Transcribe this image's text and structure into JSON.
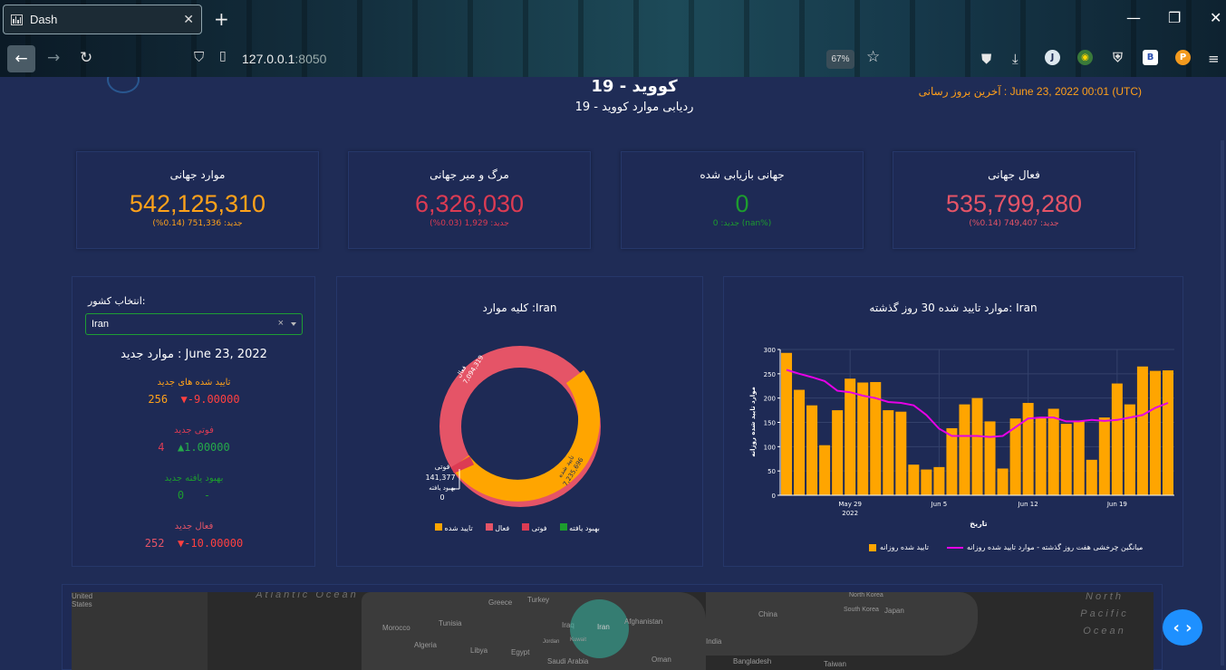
{
  "browser": {
    "tab_title": "Dash",
    "tab_close": "✕",
    "new_tab": "+",
    "url_host": "127.0.0.1",
    "url_port": ":8050",
    "zoom": "67%",
    "window_controls": [
      "—",
      "❐",
      "✕"
    ],
    "extensions": [
      "J",
      "B",
      "P"
    ]
  },
  "header": {
    "title": "کووید - 19",
    "subtitle": "ردیابی موارد کووید - 19",
    "last_update": "آخرین بروز رسانی : June 23, 2022 00:01 (UTC)"
  },
  "cards": [
    {
      "title": "موارد جهانی",
      "value": "542,125,310",
      "sub": "جدید: 751,336 (0.14%)",
      "color": "#ffa21a"
    },
    {
      "title": "مرگ و میر جهانی",
      "value": "6,326,030",
      "sub": "جدید: 1,929 (0.03%)",
      "color": "#dc3b53"
    },
    {
      "title": "جهانی بازیابی شده",
      "value": "0",
      "sub": "جدید: 0 (nan%)",
      "color": "#1d9c2e"
    },
    {
      "title": "فعال جهانی",
      "value": "535,799,280",
      "sub": "جدید: 749,407 (0.14%)",
      "color": "#e55467"
    }
  ],
  "country_panel": {
    "label": "انتخاب کشور:",
    "selected": "Iran",
    "clear": "×",
    "new_cases_date": "موارد جدید : June 23, 2022",
    "stats": [
      {
        "label": "تایید شده های جدید",
        "value": "256",
        "delta": "▼-9.00000",
        "label_color": "#ffa21a",
        "value_color": "#ffa21a",
        "delta_color": "#ff4040"
      },
      {
        "label": "فوتی جدید",
        "value": "4",
        "delta": "▲1.00000",
        "label_color": "#dc3b53",
        "value_color": "#dc3b53",
        "delta_color": "#25a94a"
      },
      {
        "label": "بهبود یافته جدید",
        "value": "0",
        "delta": "-",
        "label_color": "#1d9c2e",
        "value_color": "#1d9c2e",
        "delta_color": "#1d9c2e"
      },
      {
        "label": "فعال جدید",
        "value": "252",
        "delta": "▼-10.00000",
        "label_color": "#e55467",
        "value_color": "#e55467",
        "delta_color": "#ff4040"
      }
    ]
  },
  "donut": {
    "title": "کلیه موارد :Iran",
    "slice_labels": {
      "active": [
        "فعال",
        "7,094,319"
      ],
      "confirmed": [
        "تایید شده",
        "7,235,696"
      ],
      "deaths": [
        "فوتی",
        "141,377"
      ],
      "recovered": [
        "بهبود یافته",
        "0"
      ]
    },
    "legend": [
      {
        "label": "تایید شده",
        "color": "#ffa500"
      },
      {
        "label": "فعال",
        "color": "#e55467"
      },
      {
        "label": "فوتی",
        "color": "#dc3b53"
      },
      {
        "label": "بهبود یافته",
        "color": "#1d9c2e"
      }
    ]
  },
  "map": {
    "oceans": [
      "Atlantic Ocean",
      "North Pacific Ocean"
    ],
    "labels": [
      "United States",
      "Greece",
      "Turkey",
      "Tunisia",
      "Morocco",
      "Algeria",
      "Libya",
      "Egypt",
      "Iraq",
      "Iran",
      "Afghanistan",
      "North Korea",
      "South Korea",
      "Japan",
      "China",
      "Saudi Arabia",
      "Kuwait",
      "Oman",
      "India",
      "Bangladesh",
      "Taiwan",
      "Jordan"
    ]
  },
  "chart_data": {
    "type": "bar",
    "title": "موارد تایید شده 30 روز گذشته: Iran",
    "xlabel": "تاریخ",
    "ylabel": "موارد تایید شده روزانه",
    "ylim": [
      0,
      300
    ],
    "yticks": [
      0,
      50,
      100,
      150,
      200,
      250,
      300
    ],
    "xticks": [
      "May 29",
      "Jun 5",
      "Jun 12",
      "Jun 19"
    ],
    "xtick_sub": "2022",
    "categories": [
      "May 24",
      "May 25",
      "May 26",
      "May 27",
      "May 28",
      "May 29",
      "May 30",
      "May 31",
      "Jun 1",
      "Jun 2",
      "Jun 3",
      "Jun 4",
      "Jun 5",
      "Jun 6",
      "Jun 7",
      "Jun 8",
      "Jun 9",
      "Jun 10",
      "Jun 11",
      "Jun 12",
      "Jun 13",
      "Jun 14",
      "Jun 15",
      "Jun 16",
      "Jun 17",
      "Jun 18",
      "Jun 19",
      "Jun 20",
      "Jun 21",
      "Jun 22",
      "Jun 23"
    ],
    "series": [
      {
        "name": "تایید شده روزانه",
        "type": "bar",
        "color": "#ffa500",
        "values": [
          293,
          217,
          185,
          103,
          175,
          240,
          232,
          233,
          175,
          172,
          63,
          53,
          58,
          138,
          187,
          200,
          152,
          55,
          158,
          190,
          160,
          178,
          147,
          152,
          73,
          160,
          230,
          187,
          265,
          256,
          257
        ]
      },
      {
        "name": "میانگین چرخشی هفت روز گذشته - موارد تایید شده روزانه",
        "type": "line",
        "color": "#e600e6",
        "values": [
          258,
          250,
          243,
          235,
          215,
          212,
          205,
          200,
          192,
          190,
          185,
          165,
          137,
          122,
          122,
          122,
          120,
          122,
          140,
          158,
          160,
          160,
          152,
          152,
          155,
          153,
          155,
          160,
          165,
          180,
          190
        ]
      }
    ],
    "grid": true,
    "legend_position": "bottom"
  }
}
